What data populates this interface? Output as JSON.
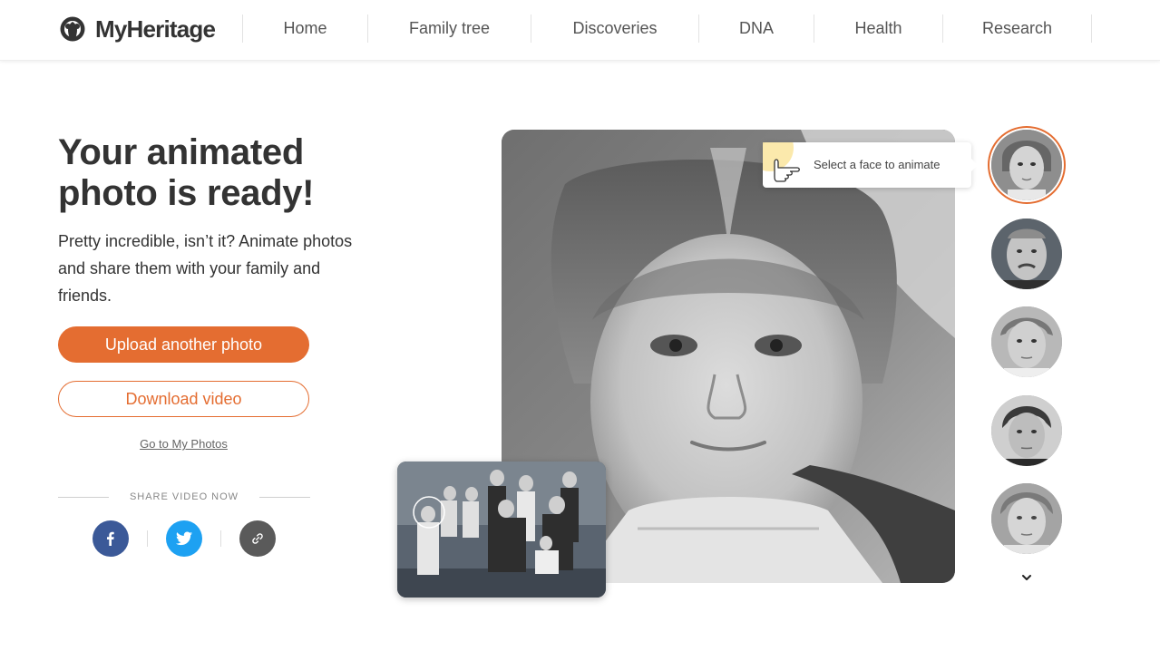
{
  "header": {
    "logo_text": "MyHeritage",
    "nav": [
      {
        "label": "Home"
      },
      {
        "label": "Family tree"
      },
      {
        "label": "Discoveries"
      },
      {
        "label": "DNA"
      },
      {
        "label": "Health"
      },
      {
        "label": "Research"
      }
    ]
  },
  "main": {
    "title_line1": "Your animated",
    "title_line2": "photo is ready!",
    "description": "Pretty incredible, isn’t it? Animate photos and share them with your family and friends.",
    "upload_button": "Upload another photo",
    "download_button": "Download video",
    "my_photos_link": "Go to My Photos",
    "share_label": "SHARE VIDEO NOW"
  },
  "tooltip": {
    "text": "Select a face to animate"
  },
  "faces": {
    "count": 5,
    "selected_index": 0
  },
  "colors": {
    "accent": "#e46d31",
    "facebook": "#3b5998",
    "twitter": "#1da1f2",
    "link_share": "#5a5a5a"
  },
  "icons": [
    "facebook-icon",
    "twitter-icon",
    "link-icon",
    "pointing-hand-icon",
    "chevron-down-icon"
  ]
}
